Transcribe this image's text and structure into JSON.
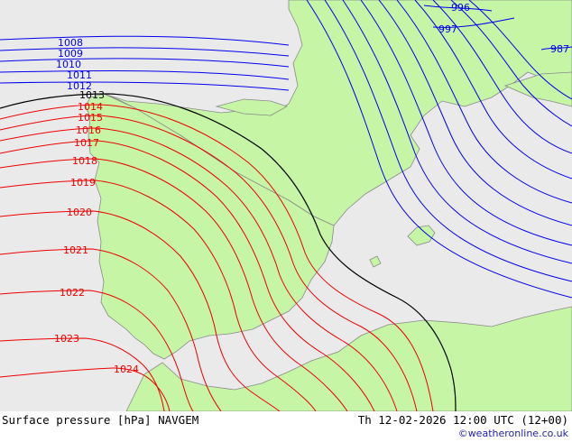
{
  "map": {
    "colors": {
      "sea": "#eaeaea",
      "land": "#c5f5a5",
      "coast": "#8a8a8a",
      "isobar_low": "#0000ee",
      "isobar_high": "#ee0000",
      "isobar_ref": "#000000"
    },
    "isobar_labels": [
      {
        "text": "1008",
        "class": "low"
      },
      {
        "text": "1009",
        "class": "low"
      },
      {
        "text": "1010",
        "class": "low"
      },
      {
        "text": "1011",
        "class": "low"
      },
      {
        "text": "1012",
        "class": "low"
      },
      {
        "text": "1013",
        "class": "ref"
      },
      {
        "text": "1014",
        "class": "high"
      },
      {
        "text": "1015",
        "class": "high"
      },
      {
        "text": "1016",
        "class": "high"
      },
      {
        "text": "1017",
        "class": "high"
      },
      {
        "text": "1018",
        "class": "high"
      },
      {
        "text": "1019",
        "class": "high"
      },
      {
        "text": "1020",
        "class": "high"
      },
      {
        "text": "1021",
        "class": "high"
      },
      {
        "text": "1022",
        "class": "high"
      },
      {
        "text": "1023",
        "class": "high"
      },
      {
        "text": "1024",
        "class": "high"
      },
      {
        "text": "996",
        "class": "low"
      },
      {
        "text": "997",
        "class": "low"
      },
      {
        "text": "987",
        "class": "low"
      }
    ]
  },
  "footer": {
    "title": "Surface pressure [hPa] NAVGEM",
    "valid_time": "Th 12-02-2026 12:00 UTC (12+00)",
    "credit": "©weatheronline.co.uk"
  }
}
